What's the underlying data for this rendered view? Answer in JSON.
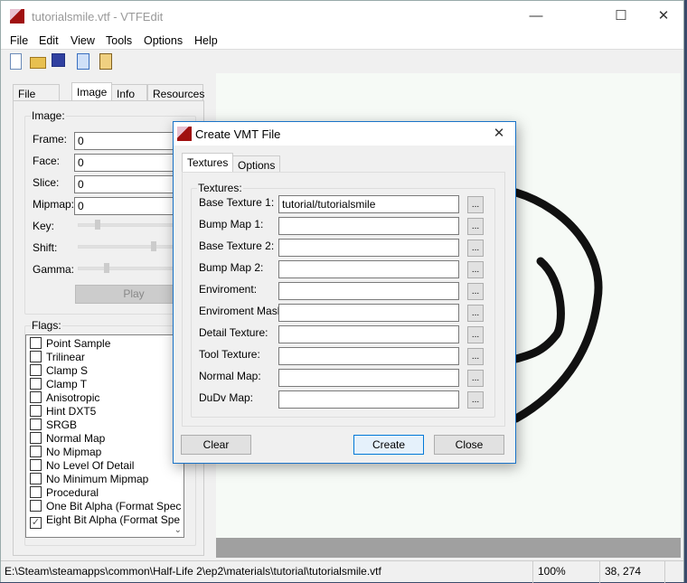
{
  "window": {
    "title": "tutorialsmile.vtf - VTFEdit",
    "minimize": "—",
    "maximize": "☐",
    "close": "✕"
  },
  "menu": [
    "File",
    "Edit",
    "View",
    "Tools",
    "Options",
    "Help"
  ],
  "toolbar": [
    "new-file-icon",
    "open-folder-icon",
    "save-icon",
    "copy-icon",
    "paste-icon"
  ],
  "left_tabs": [
    {
      "label": "File System"
    },
    {
      "label": "Image",
      "active": true
    },
    {
      "label": "Info"
    },
    {
      "label": "Resources"
    }
  ],
  "image_group": {
    "title": "Image:",
    "frame_label": "Frame:",
    "frame": "0",
    "face_label": "Face:",
    "face": "0",
    "slice_label": "Slice:",
    "slice": "0",
    "mipmap_label": "Mipmap:",
    "mipmap": "0",
    "key_label": "Key:",
    "shift_label": "Shift:",
    "gamma_label": "Gamma:",
    "play": "Play"
  },
  "flags": {
    "title": "Flags:",
    "items": [
      {
        "label": "Point Sample",
        "checked": false
      },
      {
        "label": "Trilinear",
        "checked": false
      },
      {
        "label": "Clamp S",
        "checked": false
      },
      {
        "label": "Clamp T",
        "checked": false
      },
      {
        "label": "Anisotropic",
        "checked": false
      },
      {
        "label": "Hint DXT5",
        "checked": false
      },
      {
        "label": "SRGB",
        "checked": false
      },
      {
        "label": "Normal Map",
        "checked": false
      },
      {
        "label": "No Mipmap",
        "checked": false
      },
      {
        "label": "No Level Of Detail",
        "checked": false
      },
      {
        "label": "No Minimum Mipmap",
        "checked": false
      },
      {
        "label": "Procedural",
        "checked": false
      },
      {
        "label": "One Bit Alpha (Format Spec",
        "checked": false
      },
      {
        "label": "Eight Bit Alpha (Format Spe",
        "checked": true
      }
    ]
  },
  "status": {
    "path": "E:\\Steam\\steamapps\\common\\Half-Life 2\\ep2\\materials\\tutorial\\tutorialsmile.vtf",
    "zoom": "100%",
    "coords": "38, 274"
  },
  "dialog": {
    "title": "Create VMT File",
    "close": "✕",
    "tabs": [
      {
        "label": "Textures",
        "active": true
      },
      {
        "label": "Options"
      }
    ],
    "group_title": "Textures:",
    "rows": [
      {
        "label": "Base Texture 1:",
        "value": "tutorial/tutorialsmile"
      },
      {
        "label": "Bump Map 1:",
        "value": ""
      },
      {
        "label": "Base Texture 2:",
        "value": ""
      },
      {
        "label": "Bump Map 2:",
        "value": ""
      },
      {
        "label": "Enviroment:",
        "value": ""
      },
      {
        "label": "Enviroment Mask:",
        "value": ""
      },
      {
        "label": "Detail Texture:",
        "value": ""
      },
      {
        "label": "Tool Texture:",
        "value": ""
      },
      {
        "label": "Normal Map:",
        "value": ""
      },
      {
        "label": "DuDv Map:",
        "value": ""
      }
    ],
    "browse": "...",
    "clear": "Clear",
    "create": "Create",
    "close_btn": "Close"
  }
}
